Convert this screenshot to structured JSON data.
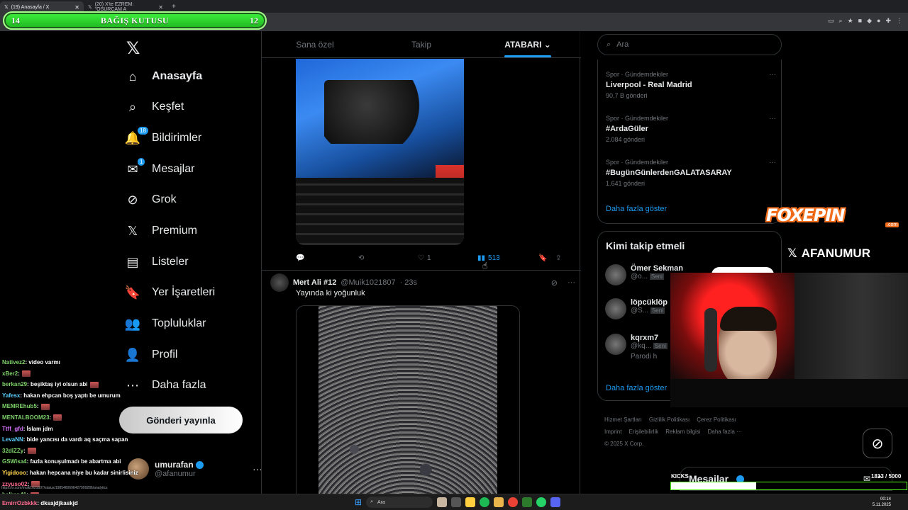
{
  "browser": {
    "tabs": [
      {
        "label": "(19) Anasayfa / X",
        "active": true
      },
      {
        "label": "(20) X'te EZREM: \"OSURCAM A",
        "active": false
      }
    ],
    "new_tab": "+"
  },
  "donation": {
    "left": "14",
    "title": "BAĞIŞ KUTUSU",
    "right": "12"
  },
  "nav": {
    "items": [
      {
        "label": "Anasayfa",
        "icon": "home-icon",
        "glyph": "⌂"
      },
      {
        "label": "Keşfet",
        "icon": "search-icon",
        "glyph": "⌕"
      },
      {
        "label": "Bildirimler",
        "icon": "bell-icon",
        "glyph": "🔔",
        "badge": "18"
      },
      {
        "label": "Mesajlar",
        "icon": "mail-icon",
        "glyph": "✉",
        "badge": "1"
      },
      {
        "label": "Grok",
        "icon": "grok-icon",
        "glyph": "⊘"
      },
      {
        "label": "Premium",
        "icon": "x-premium-icon",
        "glyph": "𝕏"
      },
      {
        "label": "Listeler",
        "icon": "list-icon",
        "glyph": "▤"
      },
      {
        "label": "Yer İşaretleri",
        "icon": "bookmark-icon",
        "glyph": "🔖"
      },
      {
        "label": "Topluluklar",
        "icon": "communities-icon",
        "glyph": "👥"
      },
      {
        "label": "Profil",
        "icon": "profile-icon",
        "glyph": "👤"
      },
      {
        "label": "Daha fazla",
        "icon": "more-circle-icon",
        "glyph": "⋯"
      }
    ],
    "post_button": "Gönderi yayınla",
    "profile": {
      "name": "umurafan",
      "handle": "@afanumur"
    }
  },
  "chat": [
    {
      "user": "Nativez2",
      "color": "#7fd36b",
      "text": ": video varmı"
    },
    {
      "user": "xBer2",
      "color": "#7fd36b",
      "text": ":",
      "emote": true
    },
    {
      "user": "berkan29",
      "color": "#7fd36b",
      "text": ": beşiktaş iyi olsun abi",
      "emote": true
    },
    {
      "user": "Yafesx",
      "color": "#5ad1ff",
      "text": ": hakan ehpcan boş yaptı be umurum"
    },
    {
      "user": "MEMREhub5",
      "color": "#7fd36b",
      "text": ":",
      "emote": true
    },
    {
      "user": "MENTALBOOM23",
      "color": "#7fd36b",
      "text": ":",
      "emote": true
    },
    {
      "user": "Ttff_gfd",
      "color": "#d774ff",
      "text": ": İslam jdm"
    },
    {
      "user": "LevaNN",
      "color": "#5ad1ff",
      "text": ": bide yancısı da vardı aq saçma sapan"
    },
    {
      "user": "32dIZZy",
      "color": "#7fd36b",
      "text": ":",
      "emote": true
    },
    {
      "user": "GSWisa4",
      "color": "#7fd36b",
      "text": ": fazla konuşulmadı be abartma abi"
    },
    {
      "user": "Yigidooo",
      "color": "#ffd34e",
      "text": ": hakan hepcana niye bu kadar sinirlisiniz"
    },
    {
      "user": "zzyuso02",
      "color": "#ff6b8f",
      "text": ":",
      "emote": true
    },
    {
      "user": "balkan41",
      "color": "#7fd36b",
      "text": ":",
      "emote": true
    }
  ],
  "chat_last": {
    "user": "EmirrOzbkkk",
    "text": ": dksajdjkaskjd"
  },
  "url_tip": "https://x.com/muik1021807/status/1985460696427999286/analytics",
  "feed": {
    "tabs": [
      "Sana özel",
      "Takip",
      "ATABARI"
    ],
    "active_tab": 2,
    "post1_actions": {
      "likes": "1",
      "views": "513"
    },
    "post2": {
      "name": "Mert Ali #12",
      "handle": "@Muik1021807",
      "time": "· 23s",
      "text": "Yayında ki yoğunluk"
    }
  },
  "search": {
    "placeholder": "Ara"
  },
  "trends": [
    {
      "category": "Spor · Gündemdekiler",
      "name": "Liverpool - Real Madrid",
      "count": "90,7 B gönderi"
    },
    {
      "category": "Spor · Gündemdekiler",
      "name": "#ArdaGüler",
      "count": "2.084 gönderi"
    },
    {
      "category": "Spor · Gündemdekiler",
      "name": "#BugünGünlerdenGALATASARAY",
      "count": "1.641 gönderi"
    }
  ],
  "show_more": "Daha fazla göster",
  "who_to_follow": {
    "title": "Kimi takip etmeli",
    "users": [
      {
        "name": "Ömer Sekman",
        "handle": "@o...",
        "tag": "Seni"
      },
      {
        "name": "löpcüklöp",
        "handle": "@S...",
        "tag": "Seni"
      },
      {
        "name": "kqrxm7",
        "handle": "@kq...",
        "tag": "Seni",
        "extra": "Parodi h"
      }
    ],
    "show_more": "Daha fazla göster"
  },
  "footer": {
    "links": [
      "Hizmet Şartları",
      "Gizlilik Politikası",
      "Çerez Politikası",
      "Imprint",
      "Erişilebilirlik",
      "Reklam bilgisi",
      "Daha fazla ···"
    ],
    "copyright": "© 2025 X Corp."
  },
  "overlay": {
    "sponsor": "FOXEPIN",
    "sponsor_tld": ".com",
    "streamer": "AFANUMUR",
    "kicks_label": "KICKS",
    "kicks_count": "1813 / 5000",
    "kicks_progress": 0.36
  },
  "messages_bar": {
    "label": "Mesajlar"
  },
  "taskbar": {
    "search": "Ara",
    "time": "00:14",
    "date": "5.11.2025"
  }
}
